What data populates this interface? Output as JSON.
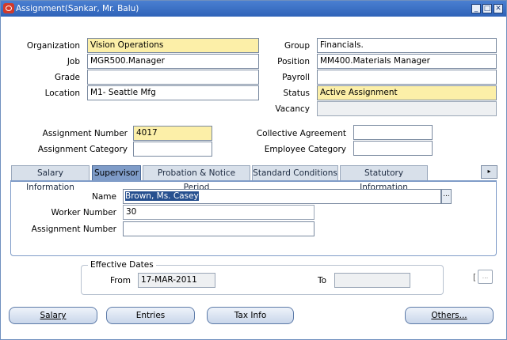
{
  "window": {
    "title": "Assignment(Sankar, Mr. Balu)"
  },
  "fields": {
    "organization": {
      "label": "Organization",
      "value": "Vision Operations"
    },
    "group": {
      "label": "Group",
      "value": "Financials."
    },
    "job": {
      "label": "Job",
      "value": "MGR500.Manager"
    },
    "position": {
      "label": "Position",
      "value": "MM400.Materials Manager"
    },
    "grade": {
      "label": "Grade",
      "value": ""
    },
    "payroll": {
      "label": "Payroll",
      "value": ""
    },
    "location": {
      "label": "Location",
      "value": "M1- Seattle Mfg"
    },
    "status": {
      "label": "Status",
      "value": "Active Assignment"
    },
    "vacancy": {
      "label": "Vacancy",
      "value": ""
    },
    "assignment_number": {
      "label": "Assignment Number",
      "value": "4017"
    },
    "collective_agreement": {
      "label": "Collective Agreement",
      "value": ""
    },
    "assignment_category": {
      "label": "Assignment Category",
      "value": ""
    },
    "employee_category": {
      "label": "Employee Category",
      "value": ""
    }
  },
  "tabs": [
    {
      "label": "Salary Information",
      "active": false
    },
    {
      "label": "Supervisor",
      "active": true
    },
    {
      "label": "Probation & Notice Period",
      "active": false
    },
    {
      "label": "Standard Conditions",
      "active": false
    },
    {
      "label": "Statutory Information",
      "active": false
    }
  ],
  "supervisor": {
    "name": {
      "label": "Name",
      "value": "Brown, Ms. Casey"
    },
    "worker_number": {
      "label": "Worker Number",
      "value": "30"
    },
    "assignment_number": {
      "label": "Assignment Number",
      "value": ""
    }
  },
  "effective_dates": {
    "title": "Effective Dates",
    "from_label": "From",
    "from_value": "17-MAR-2011",
    "to_label": "To",
    "to_value": ""
  },
  "buttons": {
    "salary": "Salary",
    "entries": "Entries",
    "tax_info": "Tax Info",
    "others": "Others..."
  },
  "misc": {
    "ellipsis": "...",
    "folder_bracket": "["
  }
}
